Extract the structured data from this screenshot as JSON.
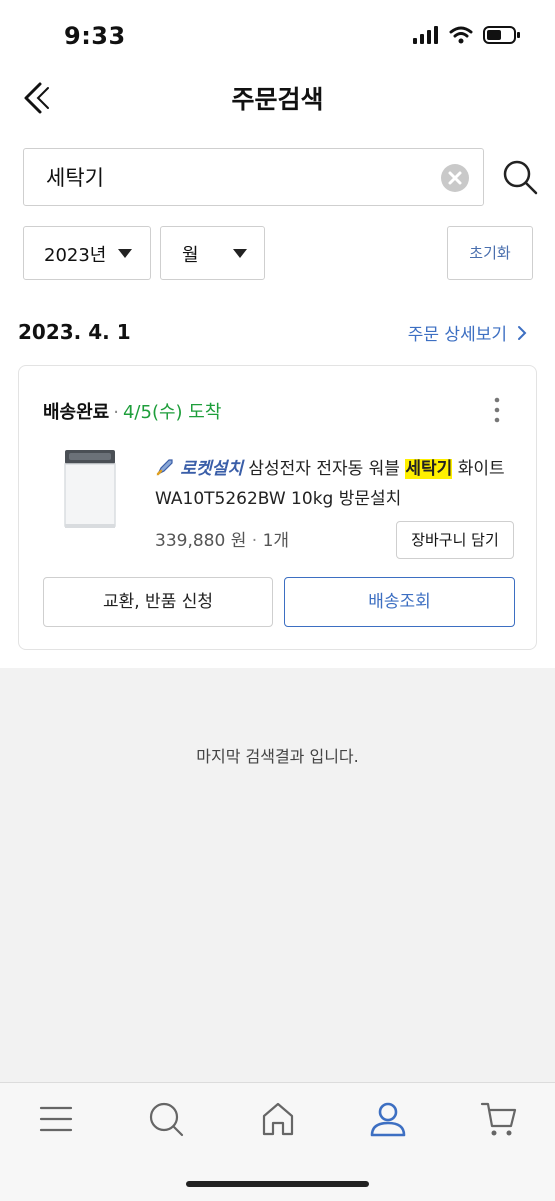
{
  "status_bar": {
    "time": "9:33",
    "icons": [
      "signal-icon",
      "wifi-icon",
      "battery-icon"
    ]
  },
  "header": {
    "title": "주문검색",
    "back_icon": "back-icon"
  },
  "search": {
    "value": "세탁기",
    "clear_icon": "clear-icon",
    "search_icon": "search-icon"
  },
  "filters": {
    "year": "2023년",
    "month": "월",
    "reset_label": "초기화"
  },
  "order": {
    "date": "2023. 4. 1",
    "detail_link": "주문 상세보기",
    "status": "배송완료",
    "separator": "·",
    "arrival": "4/5(수) 도착",
    "badge": "로켓설치",
    "name_before": "삼성전자 전자동 워블",
    "name_highlight": "세탁기",
    "name_after": "화이트 WA10T5262BW 10kg 방문설치",
    "price": "339,880 원",
    "quantity": "1개",
    "cart_button": "장바구니 담기",
    "return_button": "교환, 반품 신청",
    "track_button": "배송조회"
  },
  "end_message": "마지막 검색결과 입니다.",
  "tabbar": {
    "items": [
      "menu-icon",
      "search-icon",
      "home-icon",
      "profile-icon",
      "cart-icon"
    ],
    "active": "profile-icon"
  },
  "colors": {
    "accent": "#3d6fc2",
    "arrival": "#1e9e3b",
    "highlight": "#fff000"
  }
}
